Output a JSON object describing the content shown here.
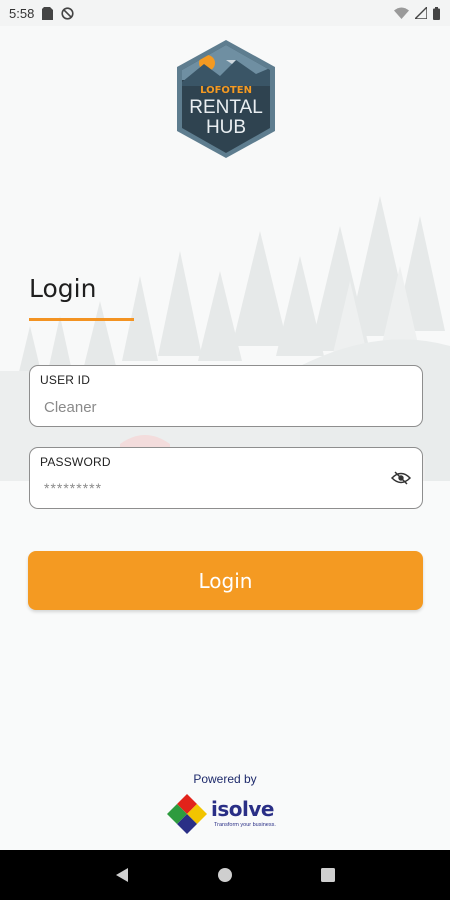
{
  "status_bar": {
    "time": "5:58",
    "icons_left": [
      "sim-card-icon",
      "no-data-icon"
    ],
    "icons_right": [
      "wifi-icon",
      "signal-icon",
      "battery-icon"
    ]
  },
  "logo": {
    "line1": "LOFOTEN",
    "line2": "RENTAL",
    "line3": "HUB"
  },
  "login": {
    "title": "Login",
    "user_id": {
      "label": "USER ID",
      "value": "Cleaner"
    },
    "password": {
      "label": "PASSWORD",
      "value": "*********"
    },
    "button_label": "Login"
  },
  "footer": {
    "powered_by": "Powered by",
    "brand_name": "isolve",
    "brand_tagline": "Transform your business."
  },
  "colors": {
    "accent": "#f49a22",
    "logo_dark": "#2f4350",
    "brand_blue": "#2a2f86"
  }
}
